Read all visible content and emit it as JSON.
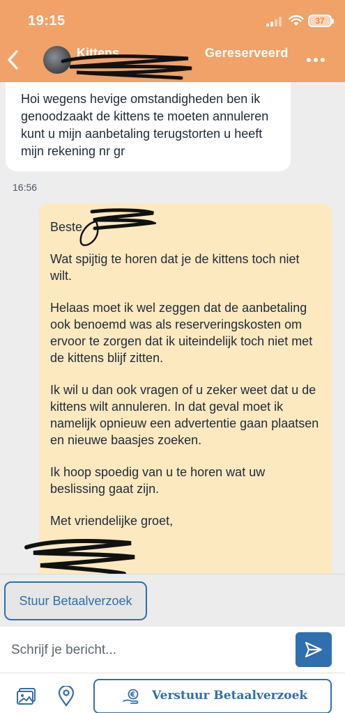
{
  "status_bar": {
    "time": "19:15",
    "battery": "37"
  },
  "header": {
    "back_icon": "chevron-left-icon",
    "chat_title": "Kittens",
    "status": "Gereserveerd",
    "more_icon": "more-horizontal-icon",
    "background_color": "#f0a268"
  },
  "messages": {
    "incoming": {
      "text": "Hoi wegens hevige omstandigheden ben ik genoodzaakt de kittens te moeten annuleren kunt u mijn aanbetaling terugstorten u heeft mijn rekening nr gr"
    },
    "timestamp": "16:56",
    "outgoing": {
      "greeting": "Beste",
      "paragraphs": [
        "Wat spijtig te horen dat je de kittens toch niet wilt.",
        "Helaas moet ik wel zeggen dat de aanbetaling ook benoemd was als reserveringskosten om ervoor te zorgen dat ik uiteindelijk toch niet met de kittens blijf zitten.",
        "Ik wil u dan ook vragen of u zeker weet dat u de kittens wilt annuleren. In dat geval moet ik namelijk opnieuw een advertentie gaan plaatsen en nieuwe baasjes zoeken.",
        "Ik hoop spoedig van u te horen wat uw beslissing gaat zijn."
      ],
      "closing": "Met vriendelijke groet,",
      "background_color": "#fde9c0"
    }
  },
  "quick_action": {
    "label": "Stuur Betaalverzoek"
  },
  "composer": {
    "placeholder": "Schrijf je bericht...",
    "send_icon": "send-icon"
  },
  "toolbar": {
    "photo_icon": "photo-icon",
    "location_icon": "location-pin-icon",
    "cta_icon": "euro-hand-icon",
    "cta_label": "Verstuur Betaalverzoek",
    "accent_color": "#2f6fae"
  }
}
